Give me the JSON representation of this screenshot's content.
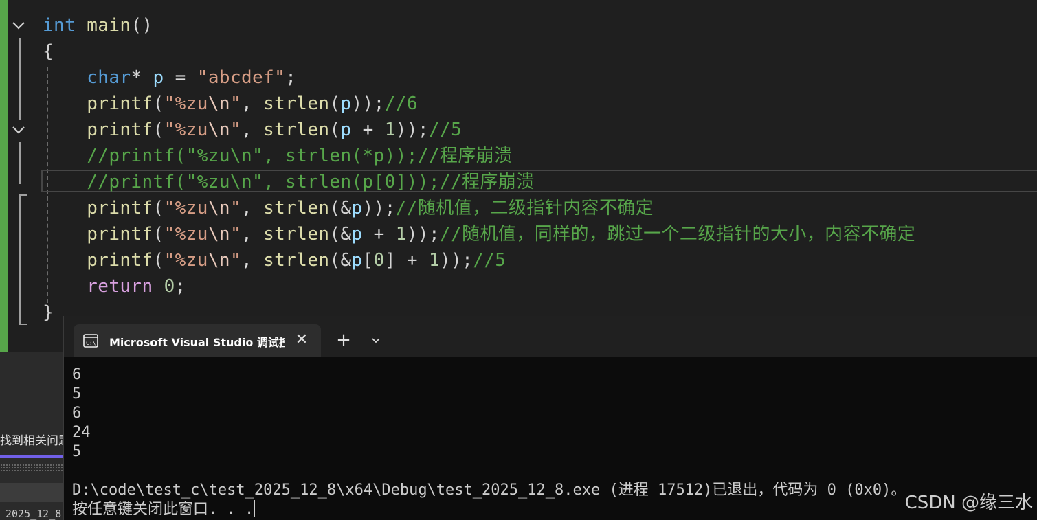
{
  "editor": {
    "lines": [
      [
        {
          "t": "int",
          "c": "kw"
        },
        {
          "t": " "
        },
        {
          "t": "main",
          "c": "fn"
        },
        {
          "t": "()",
          "c": "pun"
        }
      ],
      [
        {
          "t": "{",
          "c": "pun"
        }
      ],
      [
        {
          "t": "    "
        },
        {
          "t": "char",
          "c": "kw"
        },
        {
          "t": "* ",
          "c": "pun"
        },
        {
          "t": "p",
          "c": "var"
        },
        {
          "t": " = "
        },
        {
          "t": "\"abcdef\"",
          "c": "str"
        },
        {
          "t": ";",
          "c": "pun"
        }
      ],
      [
        {
          "t": "    "
        },
        {
          "t": "printf",
          "c": "fn"
        },
        {
          "t": "(",
          "c": "pun"
        },
        {
          "t": "\"%zu",
          "c": "str"
        },
        {
          "t": "\\n",
          "c": "esc"
        },
        {
          "t": "\"",
          "c": "str"
        },
        {
          "t": ", "
        },
        {
          "t": "strlen",
          "c": "fn"
        },
        {
          "t": "(",
          "c": "pun"
        },
        {
          "t": "p",
          "c": "var"
        },
        {
          "t": "));",
          "c": "pun"
        },
        {
          "t": "//6",
          "c": "cmt"
        }
      ],
      [
        {
          "t": "    "
        },
        {
          "t": "printf",
          "c": "fn"
        },
        {
          "t": "(",
          "c": "pun"
        },
        {
          "t": "\"%zu",
          "c": "str"
        },
        {
          "t": "\\n",
          "c": "esc"
        },
        {
          "t": "\"",
          "c": "str"
        },
        {
          "t": ", "
        },
        {
          "t": "strlen",
          "c": "fn"
        },
        {
          "t": "(",
          "c": "pun"
        },
        {
          "t": "p",
          "c": "var"
        },
        {
          "t": " + "
        },
        {
          "t": "1",
          "c": "num"
        },
        {
          "t": "));",
          "c": "pun"
        },
        {
          "t": "//5",
          "c": "cmt"
        }
      ],
      [
        {
          "t": "    "
        },
        {
          "t": "//printf(\"%zu\\n\", strlen(*p));//程序崩溃",
          "c": "cmt"
        }
      ],
      [
        {
          "t": "    "
        },
        {
          "t": "//printf(\"%zu\\n\", strlen(p[0]));//程序崩溃",
          "c": "cmt"
        }
      ],
      [
        {
          "t": "    "
        },
        {
          "t": "printf",
          "c": "fn"
        },
        {
          "t": "(",
          "c": "pun"
        },
        {
          "t": "\"%zu",
          "c": "str"
        },
        {
          "t": "\\n",
          "c": "esc"
        },
        {
          "t": "\"",
          "c": "str"
        },
        {
          "t": ", "
        },
        {
          "t": "strlen",
          "c": "fn"
        },
        {
          "t": "(&",
          "c": "pun"
        },
        {
          "t": "p",
          "c": "var"
        },
        {
          "t": "));",
          "c": "pun"
        },
        {
          "t": "//随机值，二级指针内容不确定",
          "c": "cmt"
        }
      ],
      [
        {
          "t": "    "
        },
        {
          "t": "printf",
          "c": "fn"
        },
        {
          "t": "(",
          "c": "pun"
        },
        {
          "t": "\"%zu",
          "c": "str"
        },
        {
          "t": "\\n",
          "c": "esc"
        },
        {
          "t": "\"",
          "c": "str"
        },
        {
          "t": ", "
        },
        {
          "t": "strlen",
          "c": "fn"
        },
        {
          "t": "(&",
          "c": "pun"
        },
        {
          "t": "p",
          "c": "var"
        },
        {
          "t": " + "
        },
        {
          "t": "1",
          "c": "num"
        },
        {
          "t": "));",
          "c": "pun"
        },
        {
          "t": "//随机值，同样的，跳过一个二级指针的大小，内容不确定",
          "c": "cmt"
        }
      ],
      [
        {
          "t": "    "
        },
        {
          "t": "printf",
          "c": "fn"
        },
        {
          "t": "(",
          "c": "pun"
        },
        {
          "t": "\"%zu",
          "c": "str"
        },
        {
          "t": "\\n",
          "c": "esc"
        },
        {
          "t": "\"",
          "c": "str"
        },
        {
          "t": ", "
        },
        {
          "t": "strlen",
          "c": "fn"
        },
        {
          "t": "(&",
          "c": "pun"
        },
        {
          "t": "p",
          "c": "var"
        },
        {
          "t": "[",
          "c": "pun"
        },
        {
          "t": "0",
          "c": "num"
        },
        {
          "t": "] + ",
          "c": "pun"
        },
        {
          "t": "1",
          "c": "num"
        },
        {
          "t": "));",
          "c": "pun"
        },
        {
          "t": "//5",
          "c": "cmt"
        }
      ],
      [
        {
          "t": "    "
        },
        {
          "t": "return",
          "c": "kw2"
        },
        {
          "t": " "
        },
        {
          "t": "0",
          "c": "num"
        },
        {
          "t": ";",
          "c": "pun"
        }
      ],
      [
        {
          "t": "}",
          "c": "pun"
        }
      ]
    ]
  },
  "left_panel": {
    "label": "找到相关问题",
    "footer": "2025_12_8"
  },
  "terminal": {
    "tab_title": "Microsoft Visual Studio 调试控",
    "close_glyph": "✕",
    "new_tab_glyph": "+",
    "output": [
      "6",
      "5",
      "6",
      "24",
      "5",
      "",
      "D:\\code\\test_c\\test_2025_12_8\\x64\\Debug\\test_2025_12_8.exe (进程 17512)已退出，代码为 0 (0x0)。",
      "按任意键关闭此窗口. . ."
    ]
  },
  "watermark": "CSDN @缘三水",
  "colors": {
    "editor_bg": "#1f1f1f",
    "change_bar": "#57a64a",
    "terminal_bg": "#0c0c0c",
    "comment": "#57a64a",
    "keyword": "#569cd6",
    "string": "#d69d85"
  }
}
